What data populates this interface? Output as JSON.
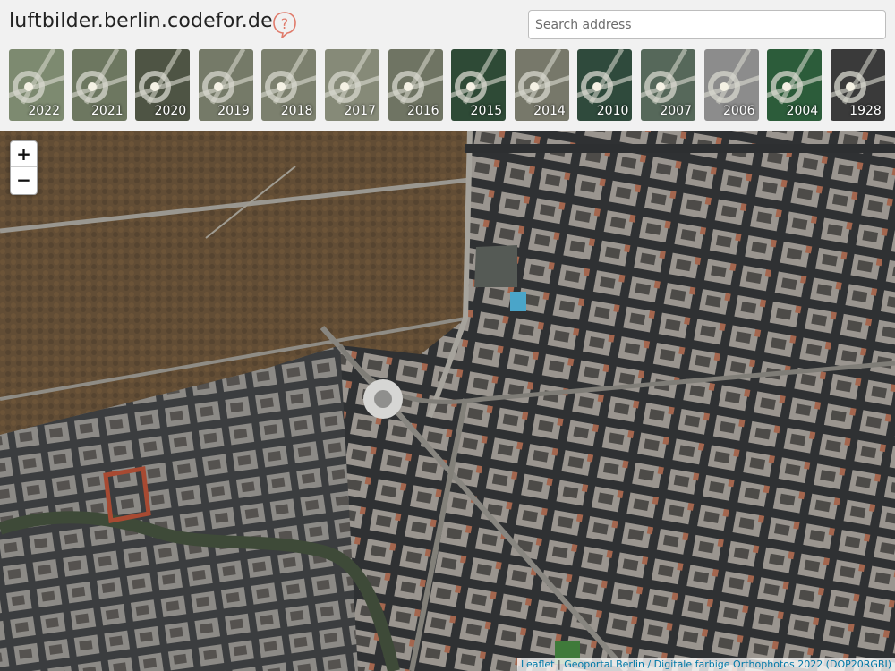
{
  "header": {
    "title": "luftbilder.berlin.codefor.de",
    "help_icon": "question-mark-bubble-icon",
    "search_placeholder": "Search address",
    "accent_color": "#e07a6a"
  },
  "years": [
    {
      "label": "2022",
      "tone": "#7d8a70"
    },
    {
      "label": "2021",
      "tone": "#6d7760"
    },
    {
      "label": "2020",
      "tone": "#4e5444"
    },
    {
      "label": "2019",
      "tone": "#757a68"
    },
    {
      "label": "2018",
      "tone": "#7c806e"
    },
    {
      "label": "2017",
      "tone": "#868a78"
    },
    {
      "label": "2016",
      "tone": "#6f7463"
    },
    {
      "label": "2015",
      "tone": "#2e4a36"
    },
    {
      "label": "2014",
      "tone": "#77786a"
    },
    {
      "label": "2010",
      "tone": "#2f4a3c"
    },
    {
      "label": "2007",
      "tone": "#56685a"
    },
    {
      "label": "2006",
      "tone": "#8c8c8c"
    },
    {
      "label": "2004",
      "tone": "#2c5c3a"
    },
    {
      "label": "1928",
      "tone": "#3a3a3a"
    }
  ],
  "map": {
    "zoom_in_label": "+",
    "zoom_out_label": "−",
    "attribution": {
      "leaflet": "Leaflet",
      "separator": " | ",
      "source": "Geoportal Berlin / Digitale farbige Orthophotos 2022 (DOP20RGBI)"
    }
  }
}
